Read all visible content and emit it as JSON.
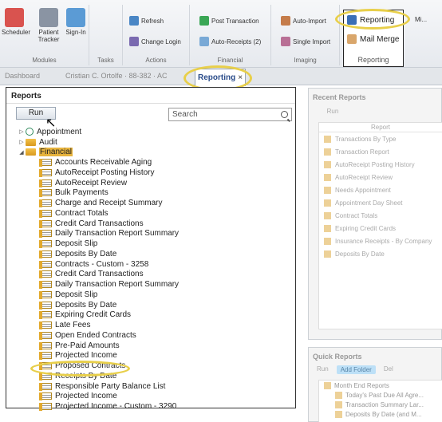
{
  "ribbon": {
    "groups": [
      {
        "label": "Modules",
        "buttons": [
          "Scheduler",
          "Patient Tracker",
          "Sign-In"
        ]
      },
      {
        "label": "Tasks"
      },
      {
        "label": "Actions",
        "buttons": [
          "Refresh",
          "Change Login"
        ]
      },
      {
        "label": "Financial",
        "buttons": [
          "Post Transaction",
          "Auto-Receipts (2)"
        ]
      },
      {
        "label": "Imaging",
        "buttons": [
          "Auto-Import",
          "Single Import"
        ]
      },
      {
        "label": "Reporting",
        "buttons": [
          "Reporting",
          "Mail Merge"
        ]
      }
    ],
    "extra_label": "Mi..."
  },
  "tabs": {
    "dashboard": "Dashboard",
    "patient": "Cristian C. Ortolfe · 88-382 · AC",
    "reporting": "Reporting",
    "close": "×"
  },
  "reports_panel": {
    "title": "Reports",
    "run_label": "Run",
    "search_placeholder": "Search",
    "tree": [
      {
        "label": "Appointment",
        "level": 0,
        "icon": "appointment-icon",
        "expanded": false
      },
      {
        "label": "Audit",
        "level": 0,
        "icon": "folder-icon",
        "expanded": false
      },
      {
        "label": "Financial",
        "level": 0,
        "icon": "folder-icon",
        "expanded": true,
        "selected": true
      },
      {
        "label": "Accounts Receivable Aging",
        "level": 1
      },
      {
        "label": "AutoReceipt Posting History",
        "level": 1
      },
      {
        "label": "AutoReceipt Review",
        "level": 1
      },
      {
        "label": "Bulk Payments",
        "level": 1
      },
      {
        "label": "Charge and Receipt Summary",
        "level": 1
      },
      {
        "label": "Contract Totals",
        "level": 1
      },
      {
        "label": "Credit Card Transactions",
        "level": 1
      },
      {
        "label": "Daily Transaction Report Summary",
        "level": 1
      },
      {
        "label": "Deposit Slip",
        "level": 1
      },
      {
        "label": "Deposits By Date",
        "level": 1
      },
      {
        "label": "Contracts - Custom - 3258",
        "level": 1
      },
      {
        "label": "Credit Card Transactions",
        "level": 1
      },
      {
        "label": "Daily Transaction Report Summary",
        "level": 1
      },
      {
        "label": "Deposit Slip",
        "level": 1
      },
      {
        "label": "Deposits By Date",
        "level": 1
      },
      {
        "label": "Expiring Credit Cards",
        "level": 1
      },
      {
        "label": "Late Fees",
        "level": 1
      },
      {
        "label": "Open Ended Contracts",
        "level": 1
      },
      {
        "label": "Pre-Paid Amounts",
        "level": 1
      },
      {
        "label": "Projected Income",
        "level": 1
      },
      {
        "label": "Proposed Contracts",
        "level": 1
      },
      {
        "label": "Receipts By Date",
        "level": 1
      },
      {
        "label": "Responsible Party Balance List",
        "level": 1
      },
      {
        "label": "Projected Income",
        "level": 1
      },
      {
        "label": "Projected Income - Custom - 3290",
        "level": 1
      }
    ]
  },
  "recent_reports": {
    "title": "Recent Reports",
    "run_label": "Run",
    "column_header": "Report",
    "items": [
      "Transactions By Type",
      "Transaction Report",
      "AutoReceipt Posting History",
      "AutoReceipt Review",
      "Needs Appointment",
      "Appointment Day Sheet",
      "Contract Totals",
      "Expiring Credit Cards",
      "Insurance Receipts - By Company",
      "Deposits By Date"
    ]
  },
  "quick_reports": {
    "title": "Quick Reports",
    "run_label": "Run",
    "add_folder_label": "Add Folder",
    "delete_label": "Del",
    "items": [
      "Month End Reports",
      "Today's Past Due All Agre...",
      "Transaction Summary Lar...",
      "Deposits By Date (and M..."
    ]
  },
  "colors": {
    "highlight": "#e8cf4a",
    "selected_folder": "#e7b33c",
    "tab_text": "#2a4c8a"
  }
}
